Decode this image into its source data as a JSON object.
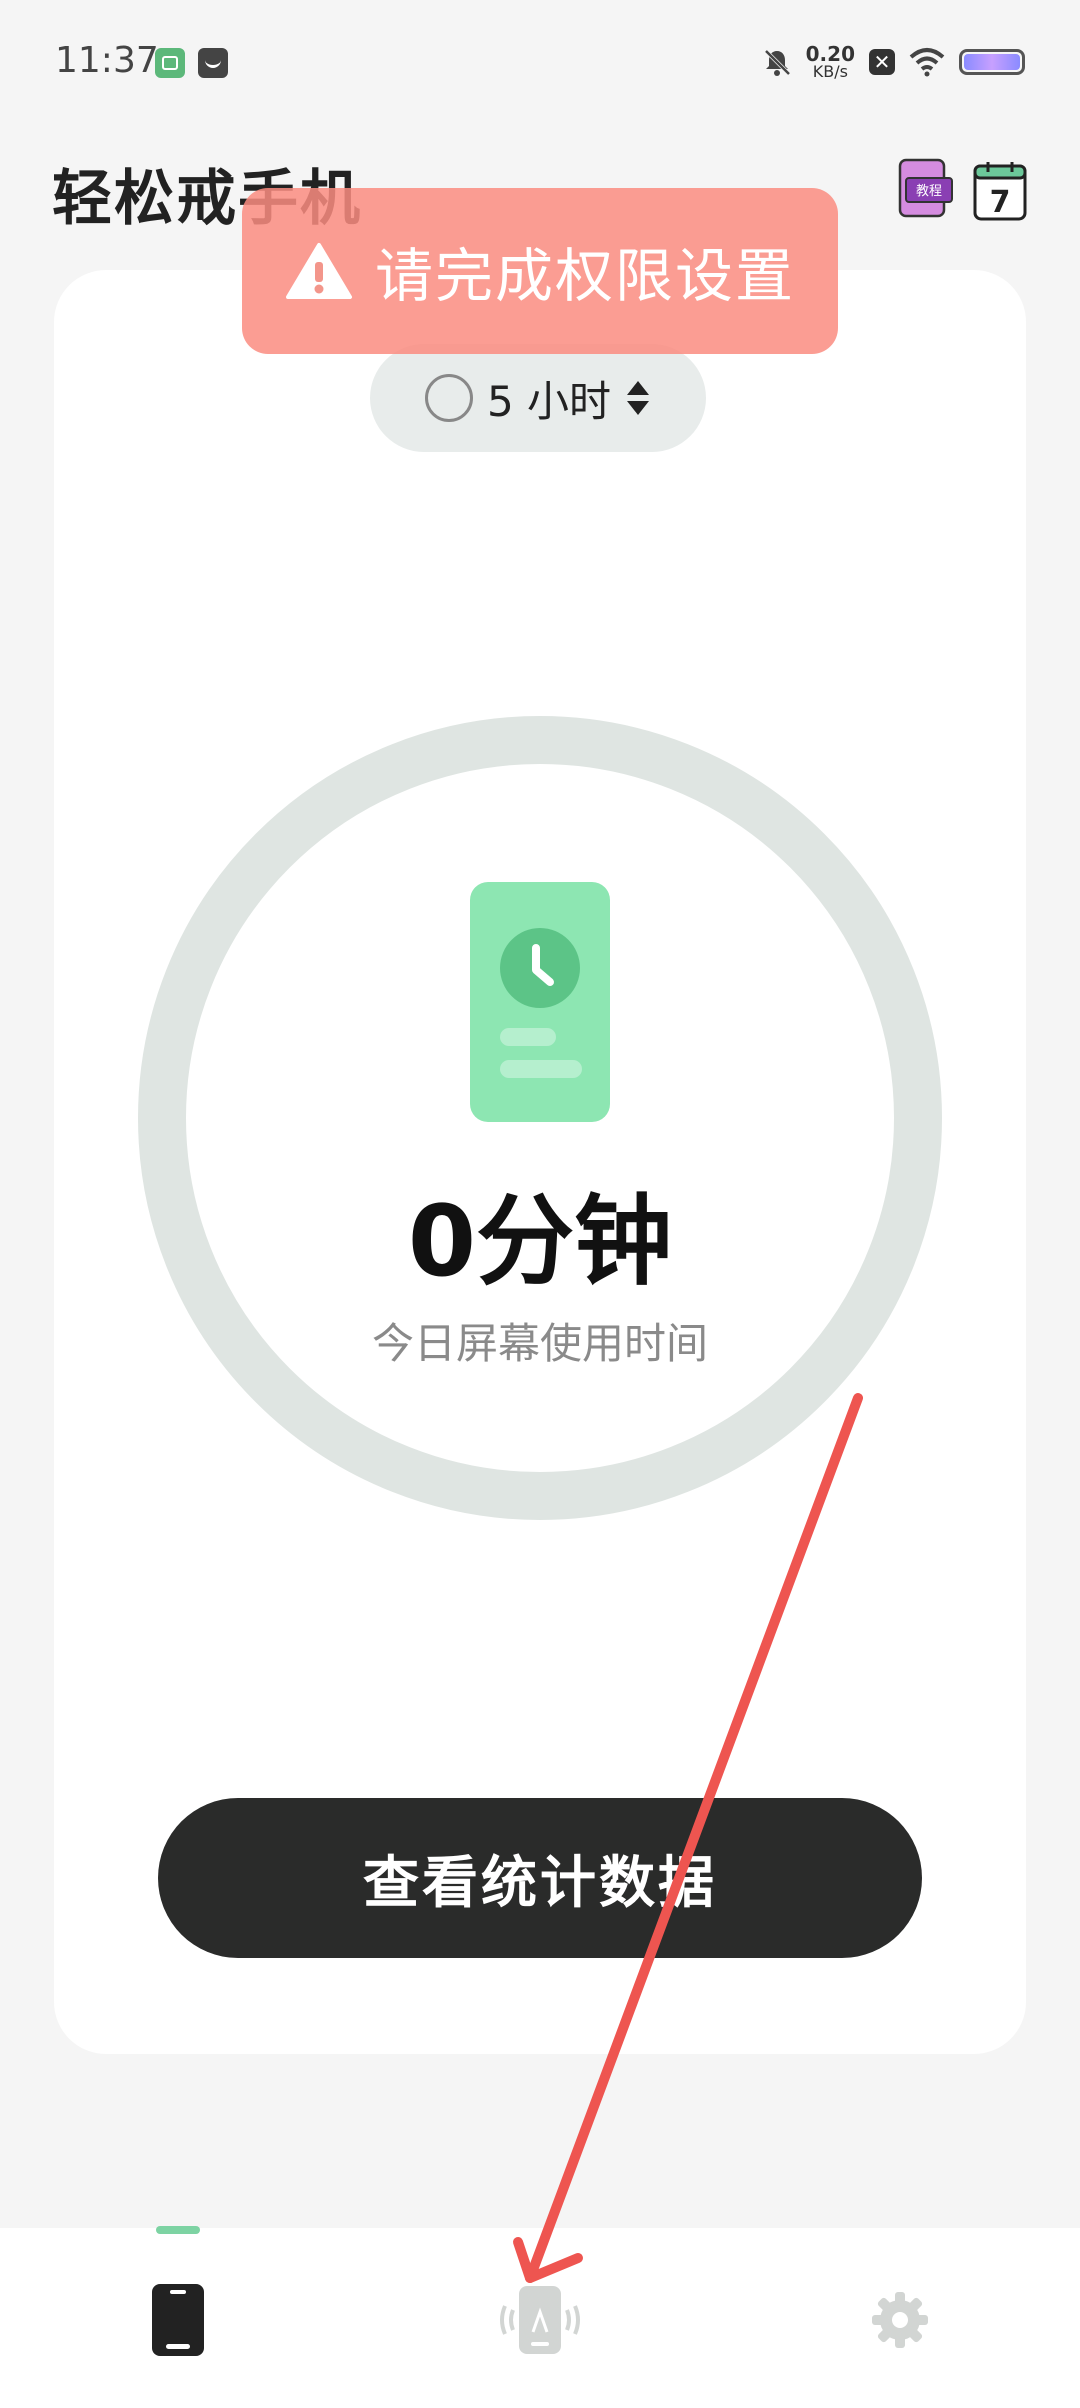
{
  "status_bar": {
    "time": "11:37",
    "net_speed": "0.20",
    "net_unit": "KB/s",
    "icons": [
      "app-notification-icon",
      "message-icon",
      "bell-muted-icon",
      "close-box-icon",
      "wifi-icon",
      "battery-icon"
    ]
  },
  "header": {
    "title": "轻松戒手机",
    "tutorial_icon_label": "教程",
    "calendar_day": "7"
  },
  "toast": {
    "text": "请完成权限设置",
    "icon": "warning-icon"
  },
  "duration_selector": {
    "value": "5 小时"
  },
  "usage": {
    "value": "0分钟",
    "caption": "今日屏幕使用时间"
  },
  "actions": {
    "stats_button": "查看统计数据"
  },
  "bottom_nav": {
    "items": [
      "phone-tab-icon",
      "focus-tab-icon",
      "settings-tab-icon"
    ],
    "active_index": 0
  },
  "colors": {
    "accent_green": "#7dd3a3",
    "toast_red": "#fa8c80",
    "button_dark": "#2a2b2a",
    "ring_gray": "#dfe5e2"
  }
}
